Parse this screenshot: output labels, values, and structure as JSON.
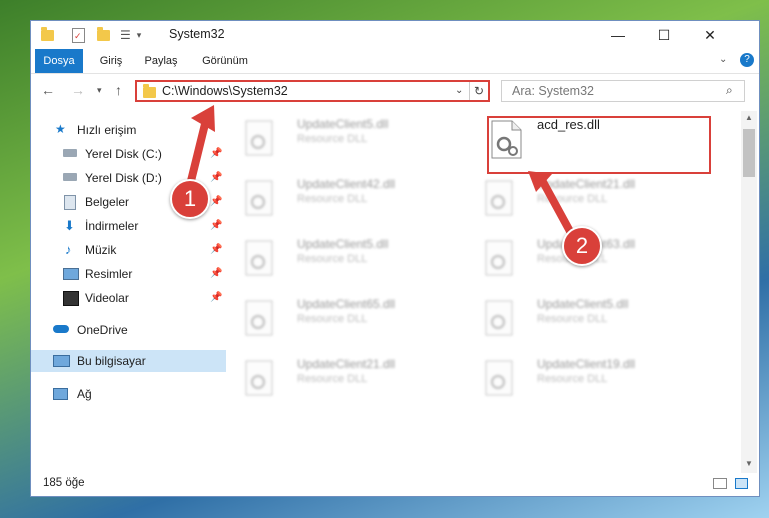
{
  "window": {
    "title": "System32"
  },
  "ribbon": {
    "tabs": [
      "Dosya",
      "Giriş",
      "Paylaş",
      "Görünüm"
    ]
  },
  "address": {
    "path": "C:\\Windows\\System32"
  },
  "search": {
    "placeholder": "Ara: System32"
  },
  "sidebar": {
    "items": [
      {
        "label": "Hızlı erişim",
        "icon": "star-icon"
      },
      {
        "label": "Yerel Disk (C:)",
        "icon": "drive-icon"
      },
      {
        "label": "Yerel Disk (D:)",
        "icon": "drive-icon"
      },
      {
        "label": "Belgeler",
        "icon": "documents-icon"
      },
      {
        "label": "İndirmeler",
        "icon": "download-icon"
      },
      {
        "label": "Müzik",
        "icon": "music-icon"
      },
      {
        "label": "Resimler",
        "icon": "pictures-icon"
      },
      {
        "label": "Videolar",
        "icon": "videos-icon"
      },
      {
        "label": "OneDrive",
        "icon": "cloud-icon"
      },
      {
        "label": "Bu bilgisayar",
        "icon": "computer-icon"
      },
      {
        "label": "Ağ",
        "icon": "network-icon"
      }
    ]
  },
  "files": [
    {
      "name": "UpdateClient5.dll",
      "desc": "Resource DLL"
    },
    {
      "name": "acd_res.dll",
      "desc": ""
    },
    {
      "name": "UpdateClient42.dll",
      "desc": "Resource DLL"
    },
    {
      "name": "UpdateClient21.dll",
      "desc": "Resource DLL"
    },
    {
      "name": "UpdateClient5.dll",
      "desc": "Resource DLL"
    },
    {
      "name": "UpdateClient63.dll",
      "desc": "Resource DLL"
    },
    {
      "name": "UpdateClient65.dll",
      "desc": "Resource DLL"
    },
    {
      "name": "UpdateClient5.dll",
      "desc": "Resource DLL"
    },
    {
      "name": "UpdateClient21.dll",
      "desc": "Resource DLL"
    },
    {
      "name": "UpdateClient19.dll",
      "desc": "Resource DLL"
    }
  ],
  "status": {
    "count": "185 öğe"
  },
  "annotations": [
    "1",
    "2"
  ],
  "colors": {
    "accent": "#1979ca",
    "highlight": "#d9403a",
    "selected": "#cce4f7"
  }
}
